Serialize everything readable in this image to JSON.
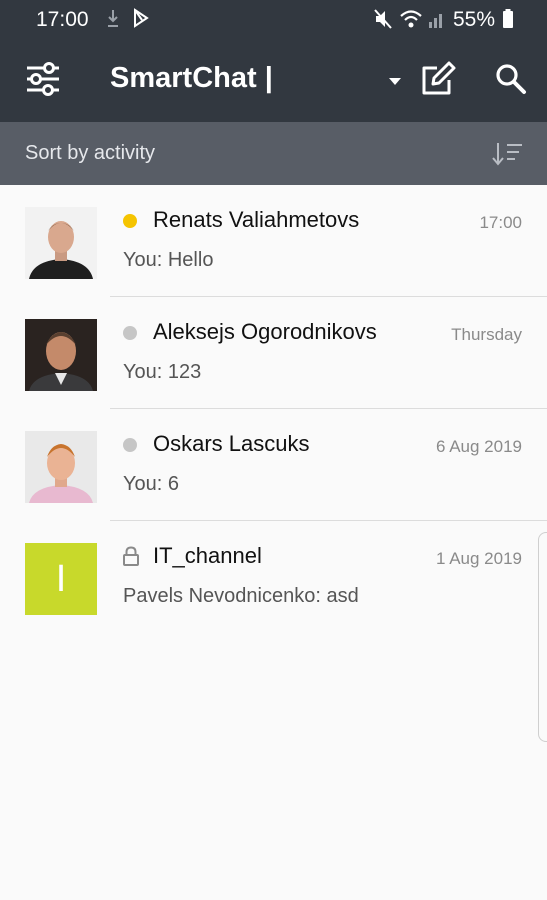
{
  "status_bar": {
    "time": "17:00",
    "battery": "55%",
    "icons": [
      "download-icon",
      "play-store-icon",
      "mute-icon",
      "wifi-icon",
      "signal-icon",
      "battery-icon"
    ]
  },
  "app_bar": {
    "title": "SmartChat |",
    "icons": [
      "filter-settings-icon",
      "dropdown-caret-icon",
      "compose-icon",
      "search-icon"
    ]
  },
  "sort_bar": {
    "label": "Sort by activity",
    "icon": "sort-icon"
  },
  "chats": [
    {
      "name": "Renats Valiahmetovs",
      "date": "17:00",
      "preview": "You: Hello",
      "status": "online",
      "status_color": "#f5c400"
    },
    {
      "name": "Aleksejs Ogorodnikovs",
      "date": "Thursday",
      "preview": "You: 123",
      "status": "offline",
      "status_color": "#c6c6c6"
    },
    {
      "name": "Oskars Lascuks",
      "date": "6 Aug 2019",
      "preview": "You: 6",
      "status": "offline",
      "status_color": "#c6c6c6"
    },
    {
      "name": "IT_channel",
      "date": "1 Aug 2019",
      "preview": "Pavels Nevodnicenko: asd",
      "status": "locked",
      "avatar_letter": "I",
      "avatar_color": "#c8d92b"
    }
  ],
  "colors": {
    "app_bar": "#323840",
    "sort_bar": "#585d66",
    "background": "#fafafa"
  }
}
